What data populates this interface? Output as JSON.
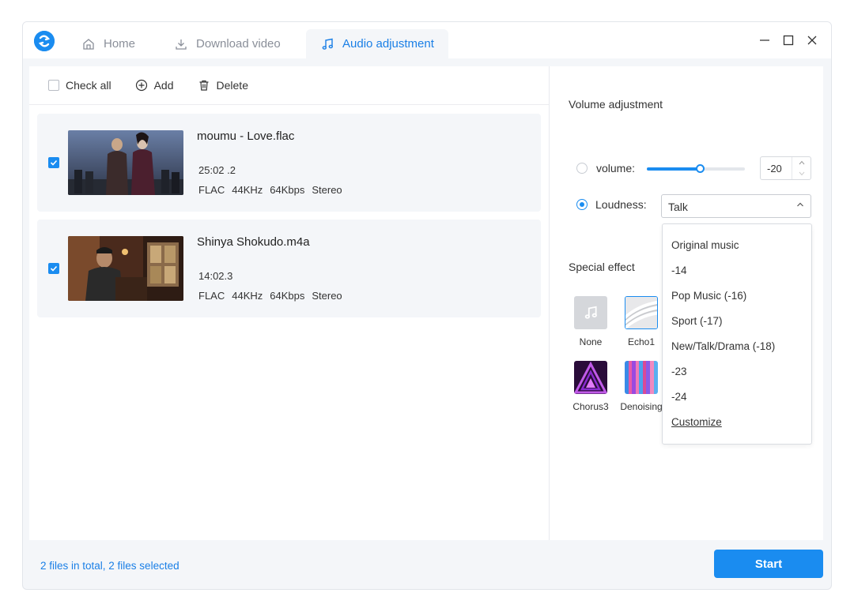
{
  "tabs": [
    {
      "label": "Home",
      "icon": "home-icon"
    },
    {
      "label": "Download video",
      "icon": "download-icon"
    },
    {
      "label": "Audio adjustment",
      "icon": "music-note-icon"
    }
  ],
  "toolbar": {
    "check_all": "Check all",
    "add": "Add",
    "delete": "Delete"
  },
  "files": [
    {
      "name": "moumu - Love.flac",
      "duration": "25:02 .2",
      "format": "FLAC",
      "rate": "44KHz",
      "bitrate": "64Kbps",
      "channels": "Stereo",
      "checked": true
    },
    {
      "name": "Shinya Shokudo.m4a",
      "duration": "14:02.3",
      "format": "FLAC",
      "rate": "44KHz",
      "bitrate": "64Kbps",
      "channels": "Stereo",
      "checked": true
    }
  ],
  "volume_adjustment": {
    "title": "Volume adjustment",
    "volume_label": "volume:",
    "volume_value": "-20",
    "slider_level": 0.54,
    "loudness_label": "Loudness:",
    "loudness_selected": "Talk",
    "loudness_options": [
      "Original music",
      "-14",
      "Pop Music (-16)",
      "Sport (-17)",
      "New/Talk/Drama (-18)",
      "-23",
      "-24",
      "Customize"
    ]
  },
  "special_effect": {
    "title": "Special effect",
    "effects": [
      "None",
      "Echo1",
      "Chorus3",
      "Denoising"
    ]
  },
  "footer": {
    "status": "2 files in total, 2 files selected",
    "start": "Start"
  },
  "colors": {
    "accent": "#1a8cf0",
    "active_tab_text": "#1a7fe6"
  }
}
